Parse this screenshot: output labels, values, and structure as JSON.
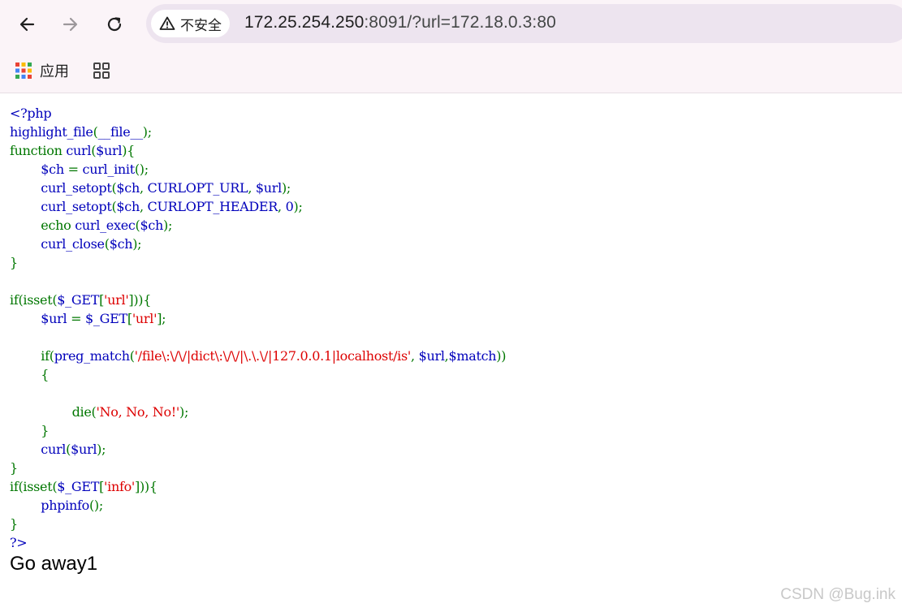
{
  "browser": {
    "back_icon": "arrow-left-icon",
    "forward_icon": "arrow-right-icon",
    "reload_icon": "reload-icon",
    "security_icon": "warning-triangle-icon",
    "security_label": "不安全",
    "url_host": "172.25.254.250",
    "url_rest": ":8091/?url=172.18.0.3:80"
  },
  "bookmarks": {
    "apps_icon": "apps-grid-icon",
    "apps_label": "应用",
    "grid_icon": "tab-groups-icon"
  },
  "code": {
    "l1": "<?php",
    "l2_fn": "highlight_file",
    "l2_p1": "(",
    "l2_arg": "__file__",
    "l2_p2": ");",
    "l3_kw": "function ",
    "l3_name": "curl",
    "l3_p1": "(",
    "l3_arg": "$url",
    "l3_p2": "){",
    "l4_indent": "        ",
    "l4_var": "$ch ",
    "l4_op": "= ",
    "l4_fn": "curl_init",
    "l4_p": "();",
    "l5_indent": "        ",
    "l5_fn": "curl_setopt",
    "l5_p1": "(",
    "l5_a1": "$ch",
    "l5_c1": ", ",
    "l5_a2": "CURLOPT_URL",
    "l5_c2": ", ",
    "l5_a3": "$url",
    "l5_p2": ");",
    "l6_indent": "        ",
    "l6_fn": "curl_setopt",
    "l6_p1": "(",
    "l6_a1": "$ch",
    "l6_c1": ", ",
    "l6_a2": "CURLOPT_HEADER",
    "l6_c2": ", ",
    "l6_a3": "0",
    "l6_p2": ");",
    "l7_indent": "        ",
    "l7_kw": "echo ",
    "l7_fn": "curl_exec",
    "l7_p1": "(",
    "l7_a1": "$ch",
    "l7_p2": ");",
    "l8_indent": "        ",
    "l8_fn": "curl_close",
    "l8_p1": "(",
    "l8_a1": "$ch",
    "l8_p2": ");",
    "l9": "}",
    "l11_kw": "if(isset(",
    "l11_var": "$_GET",
    "l11_b1": "[",
    "l11_str": "'url'",
    "l11_b2": "])){",
    "l12_indent": "        ",
    "l12_var": "$url ",
    "l12_op": "= ",
    "l12_get": "$_GET",
    "l12_b1": "[",
    "l12_str": "'url'",
    "l12_b2": "];",
    "l14_indent": "        ",
    "l14_kw": "if(",
    "l14_fn": "preg_match",
    "l14_p1": "(",
    "l14_str": "'/file\\:\\/\\/|dict\\:\\/\\/|\\.\\.\\/|127.0.0.1|localhost/is'",
    "l14_c1": ", ",
    "l14_a1": "$url",
    "l14_c2": ",",
    "l14_a2": "$match",
    "l14_p2": "))",
    "l15_indent": "        ",
    "l15": "{",
    "l17_indent": "                ",
    "l17_kw": "die(",
    "l17_str": "'No, No, No!'",
    "l17_p": ");",
    "l18_indent": "        ",
    "l18": "}",
    "l19_indent": "        ",
    "l19_fn": "curl",
    "l19_p1": "(",
    "l19_a1": "$url",
    "l19_p2": ");",
    "l20": "}",
    "l21_kw": "if(isset(",
    "l21_var": "$_GET",
    "l21_b1": "[",
    "l21_str": "'info'",
    "l21_b2": "])){",
    "l22_indent": "        ",
    "l22_fn": "phpinfo",
    "l22_p": "();",
    "l23": "}",
    "l24": "?>"
  },
  "result_text": "Go away1",
  "watermark": "CSDN @Bug.ink"
}
